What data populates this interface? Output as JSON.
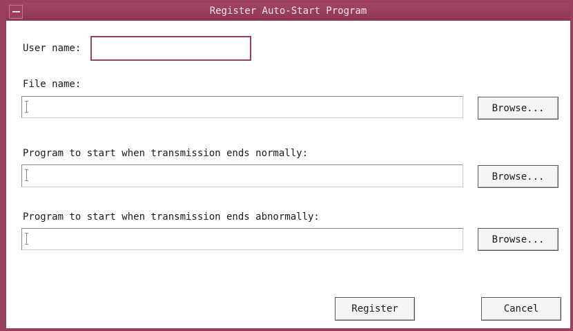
{
  "window": {
    "title": "Register Auto-Start Program"
  },
  "form": {
    "user_name_label": "User name:",
    "user_name_value": "",
    "file_name_label": "File name:",
    "file_name_value": "",
    "normal_end_label": "Program to start when transmission ends normally:",
    "normal_end_value": "",
    "abnormal_end_label": "Program to start when transmission ends abnormally:",
    "abnormal_end_value": "",
    "browse_label": "Browse..."
  },
  "footer": {
    "register_label": "Register",
    "cancel_label": "Cancel"
  },
  "colors": {
    "frame": "#9a3f5e",
    "title_text": "#f6e4ea"
  }
}
